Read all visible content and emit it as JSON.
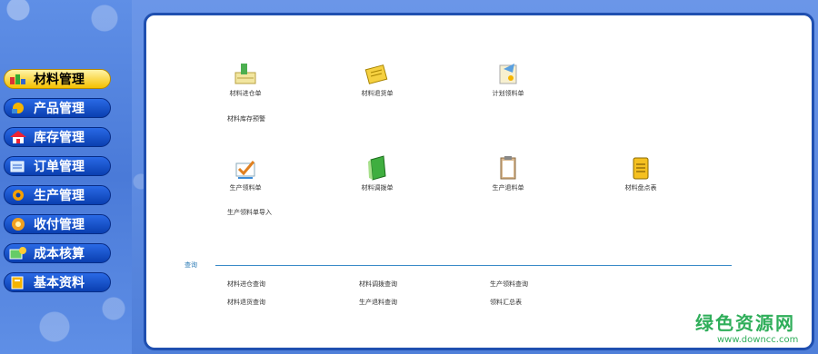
{
  "sidebar": {
    "items": [
      {
        "label": "材料管理",
        "icon": "materials-icon",
        "active": true
      },
      {
        "label": "产品管理",
        "icon": "products-icon"
      },
      {
        "label": "库存管理",
        "icon": "warehouse-icon"
      },
      {
        "label": "订单管理",
        "icon": "orders-icon"
      },
      {
        "label": "生产管理",
        "icon": "production-icon"
      },
      {
        "label": "收付管理",
        "icon": "payments-icon"
      },
      {
        "label": "成本核算",
        "icon": "cost-icon"
      },
      {
        "label": "基本资料",
        "icon": "basic-info-icon"
      }
    ]
  },
  "main": {
    "row1": [
      {
        "label": "材料进仓单",
        "icon": "stock-in-icon"
      },
      {
        "label": "材料退货单",
        "icon": "return-note-icon"
      },
      {
        "label": "计划领料单",
        "icon": "plan-requisition-icon"
      }
    ],
    "row1_link": "材料库存预警",
    "row2": [
      {
        "label": "生产领料单",
        "icon": "production-requisition-icon"
      },
      {
        "label": "材料调拨单",
        "icon": "transfer-book-icon"
      },
      {
        "label": "生产退料单",
        "icon": "clipboard-icon"
      },
      {
        "label": "材料盘点表",
        "icon": "inventory-list-icon"
      }
    ],
    "row2_link": "生产领料单导入",
    "section_label": "查询",
    "queries": [
      [
        "材料进仓查询",
        "材料调拨查询",
        "生产领料查询"
      ],
      [
        "材料退货查询",
        "生产退料查询",
        "领料汇总表"
      ]
    ]
  },
  "watermark": {
    "text": "绿色资源网",
    "url": "www.downcc.com"
  }
}
